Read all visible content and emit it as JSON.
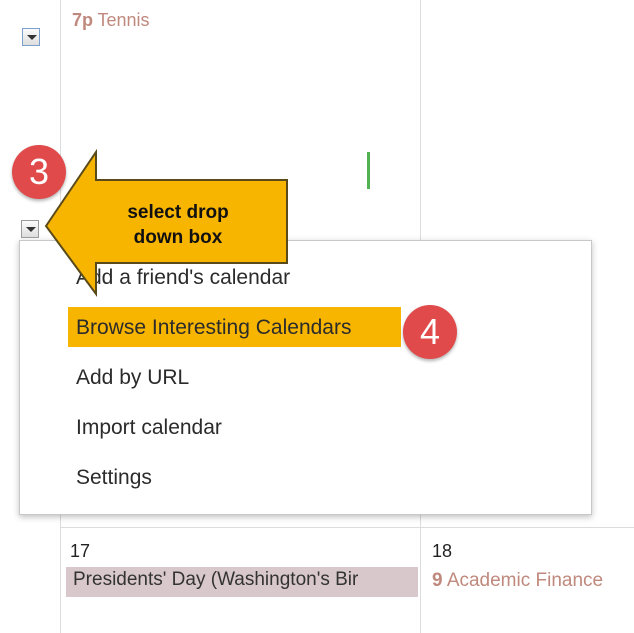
{
  "top_event": {
    "time": "7p",
    "title": "Tennis"
  },
  "callout": {
    "line1": "select drop",
    "line2": "down box"
  },
  "badges": {
    "step3": "3",
    "step4": "4"
  },
  "menu": {
    "items": [
      "Add a friend's calendar",
      "Browse Interesting Calendars",
      "Add by URL",
      "Import calendar",
      "Settings"
    ]
  },
  "days": [
    {
      "number": "17",
      "allday_event": "Presidents' Day (Washington's Bir"
    },
    {
      "number": "18",
      "event_time": "9",
      "event_title": "Academic Finance"
    }
  ],
  "colors": {
    "highlight": "#f7b500",
    "badge": "#e04a4a",
    "callout": "#f7b500",
    "event": "#c0897d"
  }
}
